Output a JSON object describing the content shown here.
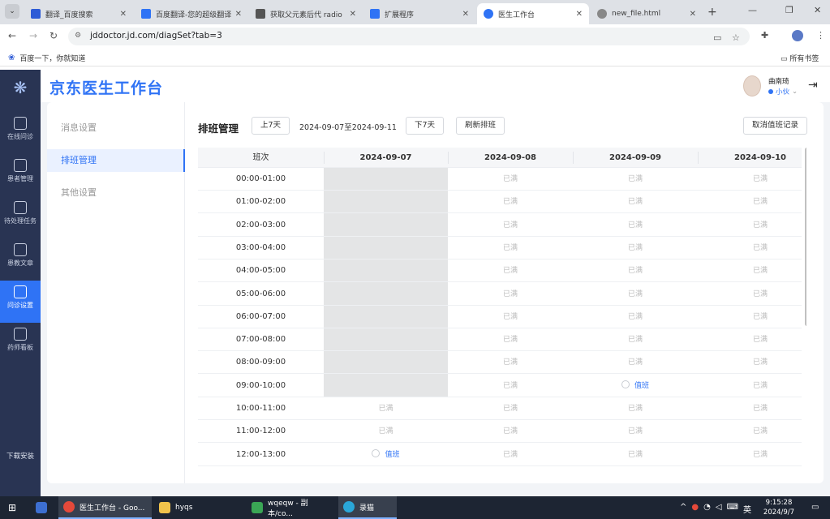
{
  "browser": {
    "tabs": [
      {
        "label": "翻译_百度搜索",
        "icon": "baidu-paw-icon",
        "color": "#2d5bd6"
      },
      {
        "label": "百度翻译-您的超级翻译",
        "icon": "baidu-translate-icon",
        "color": "#2f73f5"
      },
      {
        "label": "获取父元素后代 radio",
        "icon": "page-icon",
        "color": "#555555"
      },
      {
        "label": "扩展程序",
        "icon": "extension-icon",
        "color": "#2f73f5"
      },
      {
        "label": "医生工作台",
        "icon": "globe-icon",
        "color": "#2f73f5",
        "active": true
      },
      {
        "label": "new_file.html",
        "icon": "globe-icon",
        "color": "#666666"
      }
    ],
    "url": "jddoctor.jd.com/diagSet?tab=3",
    "bookmark": "百度一下，你就知道",
    "all_bookmarks": "所有书签"
  },
  "app": {
    "brand": "京东医生工作台",
    "accent": "#2f73f5",
    "user": {
      "name": "曲南琦",
      "status": "小伙"
    },
    "nav": [
      {
        "label": "在线问诊",
        "icon": "chat-icon"
      },
      {
        "label": "患者管理",
        "icon": "folder-icon"
      },
      {
        "label": "待处理任务",
        "icon": "calendar-clock-icon"
      },
      {
        "label": "患教文章",
        "icon": "article-icon"
      },
      {
        "label": "问诊设置",
        "icon": "settings-doc-icon",
        "active": true
      },
      {
        "label": "药师看板",
        "icon": "clipboard-icon"
      }
    ],
    "download": "下载安装",
    "subnav": [
      {
        "label": "消息设置"
      },
      {
        "label": "排班管理",
        "active": true
      },
      {
        "label": "其他设置"
      }
    ]
  },
  "schedule": {
    "title": "排班管理",
    "prev": "上7天",
    "range": "2024-09-07至2024-09-11",
    "next": "下7天",
    "refresh": "刷新排班",
    "cancel": "取消值班记录",
    "shift_header": "班次",
    "dates": [
      "2024-09-07",
      "2024-09-08",
      "2024-09-09",
      "2024-09-10"
    ],
    "rows": [
      {
        "slot": "00:00-01:00",
        "cells": [
          "",
          "已满",
          "已满",
          "已满"
        ]
      },
      {
        "slot": "01:00-02:00",
        "cells": [
          "",
          "已满",
          "已满",
          "已满"
        ]
      },
      {
        "slot": "02:00-03:00",
        "cells": [
          "",
          "已满",
          "已满",
          "已满"
        ]
      },
      {
        "slot": "03:00-04:00",
        "cells": [
          "",
          "已满",
          "已满",
          "已满"
        ]
      },
      {
        "slot": "04:00-05:00",
        "cells": [
          "",
          "已满",
          "已满",
          "已满"
        ]
      },
      {
        "slot": "05:00-06:00",
        "cells": [
          "",
          "已满",
          "已满",
          "已满"
        ]
      },
      {
        "slot": "06:00-07:00",
        "cells": [
          "",
          "已满",
          "已满",
          "已满"
        ]
      },
      {
        "slot": "07:00-08:00",
        "cells": [
          "",
          "已满",
          "已满",
          "已满"
        ]
      },
      {
        "slot": "08:00-09:00",
        "cells": [
          "",
          "已满",
          "已满",
          "已满"
        ]
      },
      {
        "slot": "09:00-10:00",
        "cells": [
          "",
          "已满",
          "值班",
          "已满"
        ]
      },
      {
        "slot": "10:00-11:00",
        "cells": [
          "已满",
          "已满",
          "已满",
          "已满"
        ]
      },
      {
        "slot": "11:00-12:00",
        "cells": [
          "已满",
          "已满",
          "已满",
          "已满"
        ]
      },
      {
        "slot": "12:00-13:00",
        "cells": [
          "值班",
          "已满",
          "已满",
          "已满"
        ]
      }
    ]
  },
  "taskbar": {
    "items": [
      {
        "label": "",
        "icon": "user-app-icon",
        "color": "#3d6fd1"
      },
      {
        "label": "医生工作台 - Goo...",
        "icon": "chrome-icon",
        "color": "#e5493a",
        "active": true
      },
      {
        "label": "hyqs",
        "icon": "folder-icon",
        "color": "#f0c24b"
      },
      {
        "label": "wqeqw - 副本/co...",
        "icon": "hbuilder-icon",
        "color": "#3aa655"
      },
      {
        "label": "录猫",
        "icon": "recorder-icon",
        "color": "#2aa7d9",
        "active": true
      }
    ],
    "ime": "英",
    "time": "9:15:28",
    "date": "2024/9/7"
  }
}
